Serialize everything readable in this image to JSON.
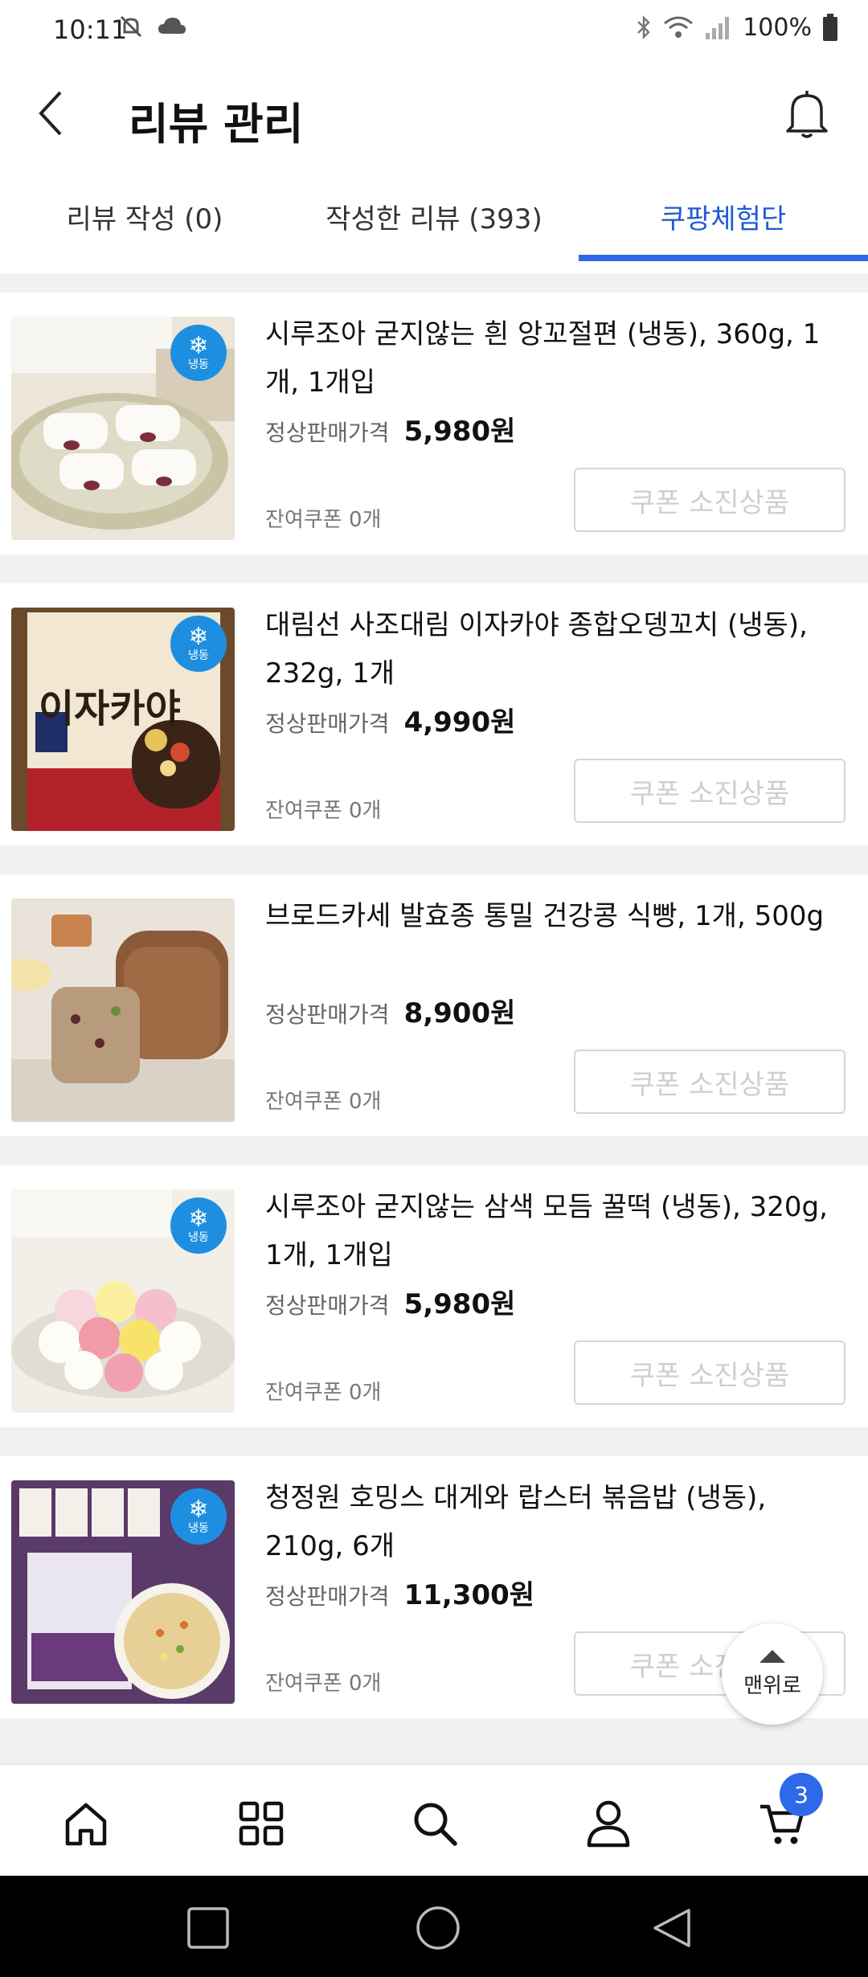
{
  "status_bar": {
    "time": "10:11",
    "battery": "100%"
  },
  "header": {
    "title": "리뷰 관리"
  },
  "tabs": [
    {
      "label": "리뷰 작성 (0)",
      "active": false
    },
    {
      "label": "작성한 리뷰 (393)",
      "active": false
    },
    {
      "label": "쿠팡체험단",
      "active": true
    }
  ],
  "common": {
    "price_label": "정상판매가격",
    "coupon_left": "잔여쿠폰 0개",
    "soldout_button": "쿠폰 소진상품",
    "frozen_badge": "냉동"
  },
  "items": [
    {
      "name": "시루조아 굳지않는 흰 앙꼬절편 (냉동), 360g, 1개, 1개입",
      "price": "5,980원",
      "frozen": true
    },
    {
      "name": "대림선 사조대림 이자카야 종합오뎅꼬치 (냉동), 232g, 1개",
      "price": "4,990원",
      "frozen": true,
      "package_text": "이자카야"
    },
    {
      "name": "브로드카세 발효종 통밀 건강콩 식빵, 1개, 500g",
      "price": "8,900원",
      "frozen": false
    },
    {
      "name": "시루조아 굳지않는 삼색 모듬 꿀떡 (냉동), 320g, 1개, 1개입",
      "price": "5,980원",
      "frozen": true
    },
    {
      "name": "청정원 호밍스 대게와 랍스터 볶음밥 (냉동), 210g, 6개",
      "price": "11,300원",
      "frozen": true
    }
  ],
  "scroll_top": {
    "label": "맨위로"
  },
  "bottom_nav": {
    "cart_count": "3"
  },
  "colors": {
    "accent": "#2e6ae8",
    "frozen_badge": "#1e8fe0"
  }
}
